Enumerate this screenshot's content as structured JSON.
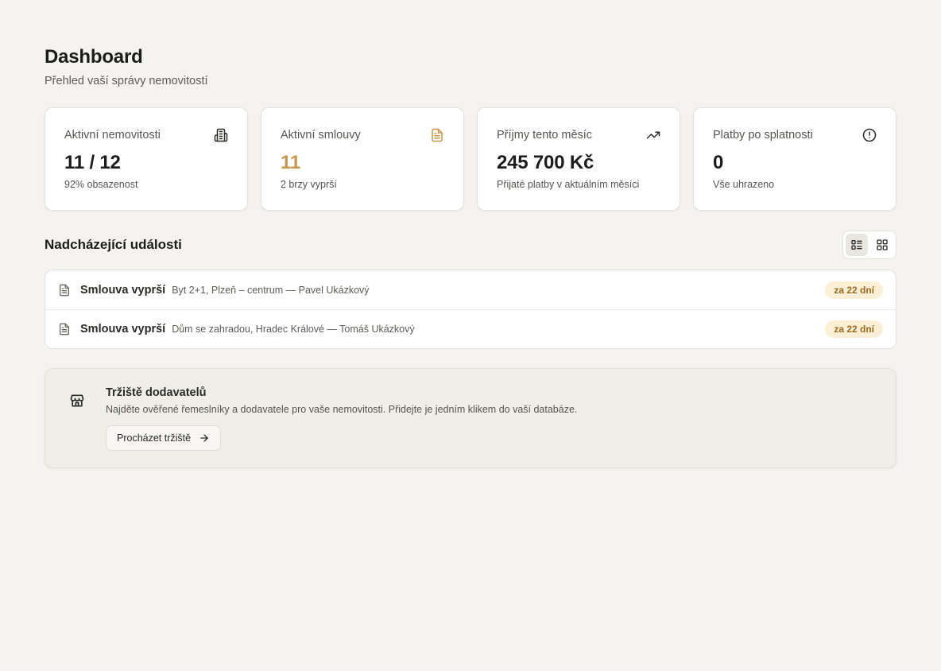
{
  "header": {
    "title": "Dashboard",
    "subtitle": "Přehled vaší správy nemovitostí"
  },
  "stats": [
    {
      "label": "Aktivní nemovitosti",
      "value": "11 / 12",
      "note": "92% obsazenost",
      "icon": "building-icon"
    },
    {
      "label": "Aktivní smlouvy",
      "value": "11",
      "note": "2 brzy vyprší",
      "icon": "document-icon",
      "accent": "#c8974a"
    },
    {
      "label": "Příjmy tento měsíc",
      "value": "245 700 Kč",
      "note": "Přijaté platby v aktuálním měsíci",
      "icon": "trending-up-icon"
    },
    {
      "label": "Platby po splatnosti",
      "value": "0",
      "note": "Vše uhrazeno",
      "icon": "alert-circle-icon"
    }
  ],
  "events": {
    "title": "Nadcházející události",
    "view_modes": [
      "list-view-icon",
      "grid-view-icon"
    ],
    "active_view": "list",
    "items": [
      {
        "title": "Smlouva vyprší",
        "detail": "Byt 2+1, Plzeň – centrum — Pavel Ukázkový",
        "badge": "za 22 dní",
        "icon": "document-icon"
      },
      {
        "title": "Smlouva vyprší",
        "detail": "Dům se zahradou, Hradec Králové — Tomáš Ukázkový",
        "badge": "za 22 dní",
        "icon": "document-icon"
      }
    ]
  },
  "marketplace": {
    "title": "Tržiště dodavatelů",
    "text": "Najděte ověřené řemeslníky a dodavatele pro vaše nemovitosti. Přidejte je jedním klikem do vaší databáze.",
    "button_label": "Procházet tržiště",
    "icon": "store-icon"
  },
  "colors": {
    "background": "#f4f3ef",
    "accent": "#c8974a",
    "badge_bg": "#fbf0d6",
    "badge_text": "#9c6a1e"
  }
}
